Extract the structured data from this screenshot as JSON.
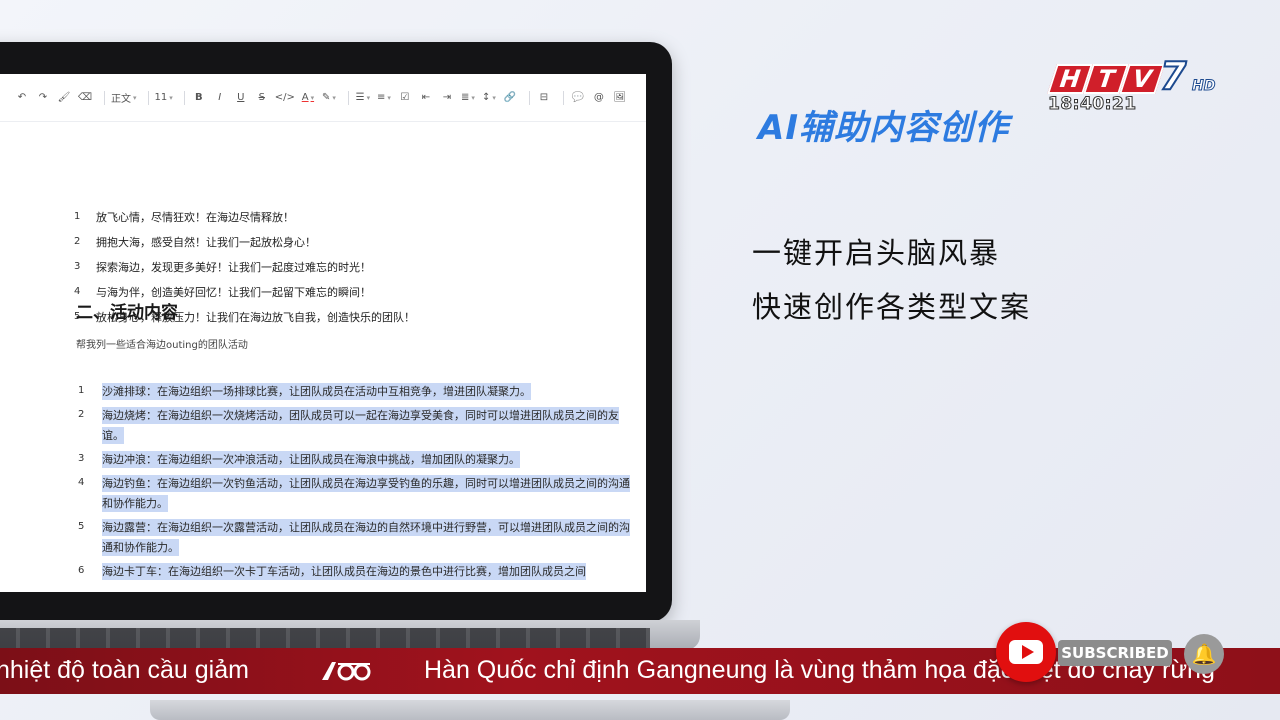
{
  "right_panel": {
    "title": "AI辅助内容创作",
    "line1": "一键开启头脑风暴",
    "line2": "快速创作各类型文案"
  },
  "channel": {
    "logo_letters": [
      "H",
      "T",
      "V"
    ],
    "logo_number": "7",
    "logo_hd": "HD",
    "clock": "18:40:21"
  },
  "toolbar": {
    "undo": "↶",
    "redo": "↷",
    "format_paint": "🖌",
    "clear_format": "⌫",
    "style": "正文",
    "font_size": "11",
    "bold": "B",
    "italic": "I",
    "underline": "U",
    "strikethrough": "S",
    "code": "</>",
    "font_color": "A",
    "highlight": "✎",
    "bullet_list": "☰",
    "numbered_list": "≡",
    "task": "☑",
    "indent_left": "⇤",
    "indent_right": "⇥",
    "align": "≣",
    "line_height": "↕",
    "link": "🔗",
    "block": "⊟",
    "comment": "💬",
    "mention": "@",
    "image": "🖼"
  },
  "document": {
    "slogans": [
      {
        "num": "1",
        "text": "放飞心情，尽情狂欢！在海边尽情释放！"
      },
      {
        "num": "2",
        "text": "拥抱大海，感受自然！让我们一起放松身心！"
      },
      {
        "num": "3",
        "text": "探索海边，发现更多美好！让我们一起度过难忘的时光！"
      },
      {
        "num": "4",
        "text": "与海为伴，创造美好回忆！让我们一起留下难忘的瞬间！"
      },
      {
        "num": "5",
        "text": "放松身心，释放压力！让我们在海边放飞自我，创造快乐的团队！"
      }
    ],
    "section_heading": "二、活动内容",
    "prompt": "帮我列一些适合海边outing的团队活动",
    "activities": [
      {
        "num": "1",
        "text": "沙滩排球：在海边组织一场排球比赛，让团队成员在活动中互相竞争，增进团队凝聚力。"
      },
      {
        "num": "2",
        "text": "海边烧烤：在海边组织一次烧烤活动，团队成员可以一起在海边享受美食，同时可以增进团队成员之间的友谊。"
      },
      {
        "num": "3",
        "text": "海边冲浪：在海边组织一次冲浪活动，让团队成员在海浪中挑战，增加团队的凝聚力。"
      },
      {
        "num": "4",
        "text": "海边钓鱼：在海边组织一次钓鱼活动，让团队成员在海边享受钓鱼的乐趣，同时可以增进团队成员之间的沟通和协作能力。"
      },
      {
        "num": "5",
        "text": "海边露营：在海边组织一次露营活动，让团队成员在海边的自然环境中进行野营，可以增进团队成员之间的沟通和协作能力。"
      },
      {
        "num": "6",
        "text": "海边卡丁车：在海边组织一次卡丁车活动，让团队成员在海边的景色中进行比赛，增加团队成员之间"
      }
    ]
  },
  "subscribe": {
    "label": "SUBSCRIBED",
    "bell": "🔔"
  },
  "ticker": {
    "left_text": "nhiệt độ toàn cầu giảm",
    "logo_text": "ĻĐ",
    "right_text": "Hàn Quốc chỉ định Gangneung là vùng thảm họa đặc biệt do cháy rừng"
  }
}
